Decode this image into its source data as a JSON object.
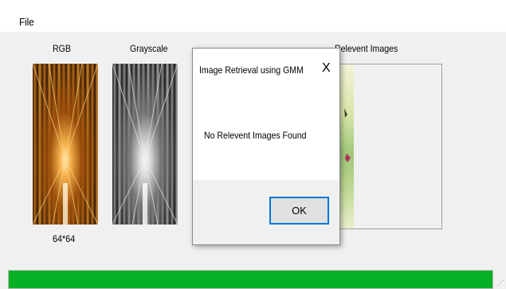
{
  "menu": {
    "file_label": "File"
  },
  "columns": {
    "rgb_label": "RGB",
    "grayscale_label": "Grayscale",
    "relevant_label": "Relevent Images"
  },
  "image_size_label": "64*64",
  "dialog": {
    "title": "Image Retrieval using GMM",
    "close_glyph": "X",
    "message": "No Relevent Images Found",
    "ok_label": "OK"
  },
  "progress": {
    "fraction": 1.0,
    "color": "#06b025"
  },
  "icons": [
    "close-icon",
    "resize-grip-icon"
  ]
}
